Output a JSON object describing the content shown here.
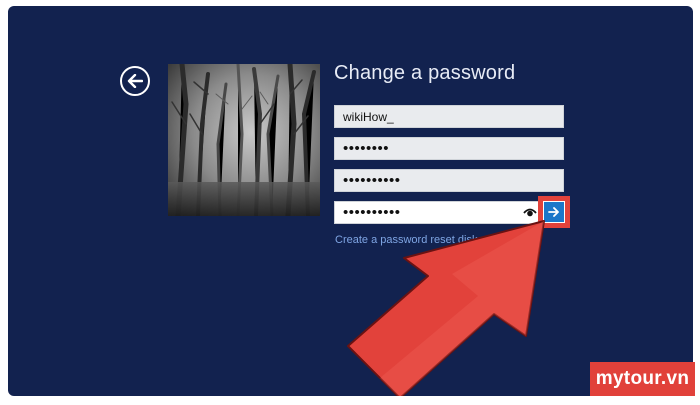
{
  "screen": {
    "title": "Change a password",
    "back_icon": "back-arrow-circle-icon",
    "user_image": "misty-forest-photo"
  },
  "form": {
    "username": "wikiHow_",
    "old_password_mask": "••••••••",
    "new_password_mask": "••••••••••",
    "confirm_password_mask": "••••••••••",
    "reveal_icon": "eye-icon",
    "submit_icon": "arrow-right-icon",
    "reset_disk_link": "Create a password reset disk"
  },
  "annotation": {
    "pointer_color": "#e2423b",
    "highlight_color": "#e2423b"
  },
  "watermark": {
    "text": "mytour.vn"
  }
}
